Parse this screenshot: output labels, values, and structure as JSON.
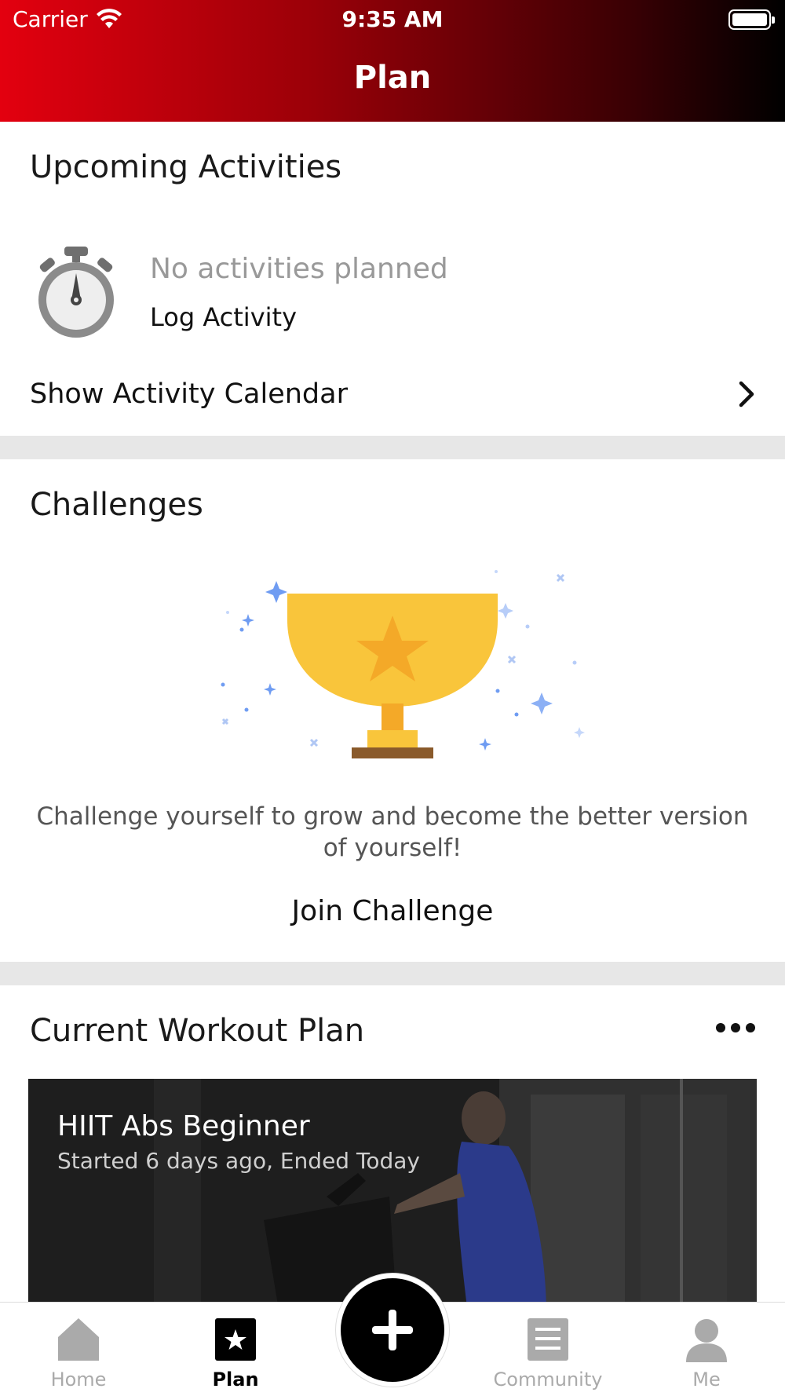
{
  "status_bar": {
    "carrier": "Carrier",
    "time": "9:35 AM"
  },
  "nav": {
    "title": "Plan"
  },
  "upcoming": {
    "title": "Upcoming Activities",
    "empty_text": "No activities planned",
    "log_activity_label": "Log Activity",
    "calendar_label": "Show Activity Calendar"
  },
  "challenges": {
    "title": "Challenges",
    "description": "Challenge yourself to grow and become the better version of yourself!",
    "join_label": "Join Challenge"
  },
  "workout_plan": {
    "title": "Current Workout Plan",
    "card": {
      "name": "HIIT Abs Beginner",
      "status": "Started 6 days ago, Ended Today"
    }
  },
  "tabbar": {
    "tabs": [
      {
        "label": "Home",
        "icon": "home-icon",
        "active": false
      },
      {
        "label": "Plan",
        "icon": "plan-star-icon",
        "active": true
      },
      {
        "label": "Community",
        "icon": "community-icon",
        "active": false
      },
      {
        "label": "Me",
        "icon": "profile-icon",
        "active": false
      }
    ],
    "fab_icon": "plus-icon"
  },
  "colors": {
    "header_start": "#e3000f",
    "header_end": "#000000",
    "trophy": "#f9c53b",
    "trophy_star": "#f4a928",
    "tab_inactive": "#aaaaaa",
    "tab_active": "#000000"
  }
}
